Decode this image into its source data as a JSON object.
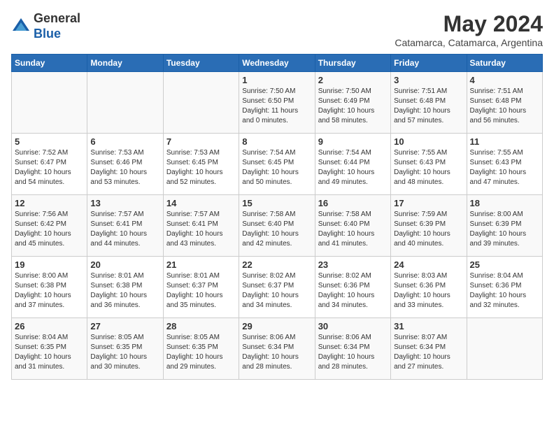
{
  "header": {
    "logo_general": "General",
    "logo_blue": "Blue",
    "title": "May 2024",
    "location": "Catamarca, Catamarca, Argentina"
  },
  "calendar": {
    "days_of_week": [
      "Sunday",
      "Monday",
      "Tuesday",
      "Wednesday",
      "Thursday",
      "Friday",
      "Saturday"
    ],
    "weeks": [
      [
        {
          "day": "",
          "info": ""
        },
        {
          "day": "",
          "info": ""
        },
        {
          "day": "",
          "info": ""
        },
        {
          "day": "1",
          "info": "Sunrise: 7:50 AM\nSunset: 6:50 PM\nDaylight: 11 hours\nand 0 minutes."
        },
        {
          "day": "2",
          "info": "Sunrise: 7:50 AM\nSunset: 6:49 PM\nDaylight: 10 hours\nand 58 minutes."
        },
        {
          "day": "3",
          "info": "Sunrise: 7:51 AM\nSunset: 6:48 PM\nDaylight: 10 hours\nand 57 minutes."
        },
        {
          "day": "4",
          "info": "Sunrise: 7:51 AM\nSunset: 6:48 PM\nDaylight: 10 hours\nand 56 minutes."
        }
      ],
      [
        {
          "day": "5",
          "info": "Sunrise: 7:52 AM\nSunset: 6:47 PM\nDaylight: 10 hours\nand 54 minutes."
        },
        {
          "day": "6",
          "info": "Sunrise: 7:53 AM\nSunset: 6:46 PM\nDaylight: 10 hours\nand 53 minutes."
        },
        {
          "day": "7",
          "info": "Sunrise: 7:53 AM\nSunset: 6:45 PM\nDaylight: 10 hours\nand 52 minutes."
        },
        {
          "day": "8",
          "info": "Sunrise: 7:54 AM\nSunset: 6:45 PM\nDaylight: 10 hours\nand 50 minutes."
        },
        {
          "day": "9",
          "info": "Sunrise: 7:54 AM\nSunset: 6:44 PM\nDaylight: 10 hours\nand 49 minutes."
        },
        {
          "day": "10",
          "info": "Sunrise: 7:55 AM\nSunset: 6:43 PM\nDaylight: 10 hours\nand 48 minutes."
        },
        {
          "day": "11",
          "info": "Sunrise: 7:55 AM\nSunset: 6:43 PM\nDaylight: 10 hours\nand 47 minutes."
        }
      ],
      [
        {
          "day": "12",
          "info": "Sunrise: 7:56 AM\nSunset: 6:42 PM\nDaylight: 10 hours\nand 45 minutes."
        },
        {
          "day": "13",
          "info": "Sunrise: 7:57 AM\nSunset: 6:41 PM\nDaylight: 10 hours\nand 44 minutes."
        },
        {
          "day": "14",
          "info": "Sunrise: 7:57 AM\nSunset: 6:41 PM\nDaylight: 10 hours\nand 43 minutes."
        },
        {
          "day": "15",
          "info": "Sunrise: 7:58 AM\nSunset: 6:40 PM\nDaylight: 10 hours\nand 42 minutes."
        },
        {
          "day": "16",
          "info": "Sunrise: 7:58 AM\nSunset: 6:40 PM\nDaylight: 10 hours\nand 41 minutes."
        },
        {
          "day": "17",
          "info": "Sunrise: 7:59 AM\nSunset: 6:39 PM\nDaylight: 10 hours\nand 40 minutes."
        },
        {
          "day": "18",
          "info": "Sunrise: 8:00 AM\nSunset: 6:39 PM\nDaylight: 10 hours\nand 39 minutes."
        }
      ],
      [
        {
          "day": "19",
          "info": "Sunrise: 8:00 AM\nSunset: 6:38 PM\nDaylight: 10 hours\nand 37 minutes."
        },
        {
          "day": "20",
          "info": "Sunrise: 8:01 AM\nSunset: 6:38 PM\nDaylight: 10 hours\nand 36 minutes."
        },
        {
          "day": "21",
          "info": "Sunrise: 8:01 AM\nSunset: 6:37 PM\nDaylight: 10 hours\nand 35 minutes."
        },
        {
          "day": "22",
          "info": "Sunrise: 8:02 AM\nSunset: 6:37 PM\nDaylight: 10 hours\nand 34 minutes."
        },
        {
          "day": "23",
          "info": "Sunrise: 8:02 AM\nSunset: 6:36 PM\nDaylight: 10 hours\nand 34 minutes."
        },
        {
          "day": "24",
          "info": "Sunrise: 8:03 AM\nSunset: 6:36 PM\nDaylight: 10 hours\nand 33 minutes."
        },
        {
          "day": "25",
          "info": "Sunrise: 8:04 AM\nSunset: 6:36 PM\nDaylight: 10 hours\nand 32 minutes."
        }
      ],
      [
        {
          "day": "26",
          "info": "Sunrise: 8:04 AM\nSunset: 6:35 PM\nDaylight: 10 hours\nand 31 minutes."
        },
        {
          "day": "27",
          "info": "Sunrise: 8:05 AM\nSunset: 6:35 PM\nDaylight: 10 hours\nand 30 minutes."
        },
        {
          "day": "28",
          "info": "Sunrise: 8:05 AM\nSunset: 6:35 PM\nDaylight: 10 hours\nand 29 minutes."
        },
        {
          "day": "29",
          "info": "Sunrise: 8:06 AM\nSunset: 6:34 PM\nDaylight: 10 hours\nand 28 minutes."
        },
        {
          "day": "30",
          "info": "Sunrise: 8:06 AM\nSunset: 6:34 PM\nDaylight: 10 hours\nand 28 minutes."
        },
        {
          "day": "31",
          "info": "Sunrise: 8:07 AM\nSunset: 6:34 PM\nDaylight: 10 hours\nand 27 minutes."
        },
        {
          "day": "",
          "info": ""
        }
      ]
    ]
  }
}
